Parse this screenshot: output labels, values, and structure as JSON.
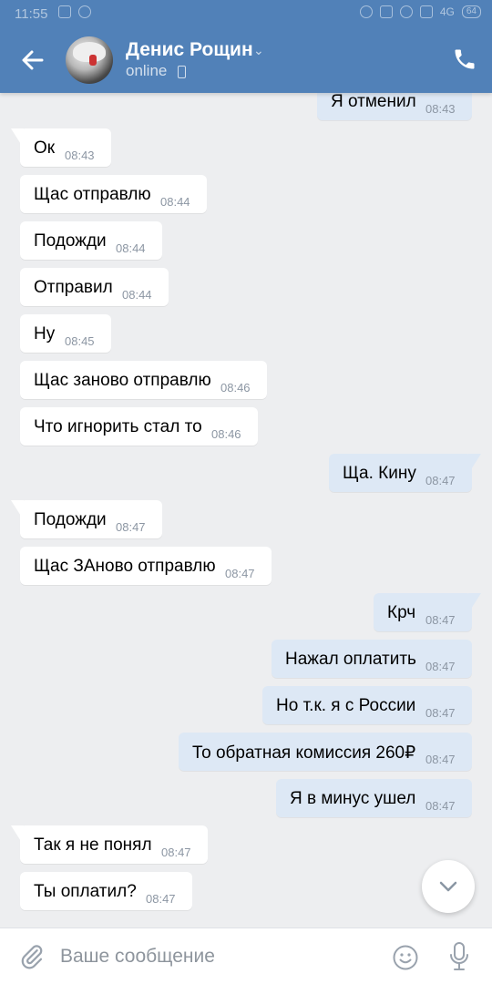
{
  "status_bar": {
    "time": "11:55",
    "network": "4G",
    "battery": "64"
  },
  "header": {
    "contact_name": "Денис Рощин",
    "status": "online",
    "colors": {
      "bar": "#5181b8"
    },
    "icons": {
      "back": "arrow-left-icon",
      "call": "phone-icon",
      "chevron": "chevron-down-icon",
      "device": "mobile-device-icon"
    }
  },
  "messages": [
    {
      "dir": "out",
      "text": "Я отменил",
      "time": "08:43",
      "tail": false
    },
    {
      "dir": "in",
      "text": "Ок",
      "time": "08:43",
      "tail": true
    },
    {
      "dir": "in",
      "text": "Щас отправлю",
      "time": "08:44",
      "tail": false
    },
    {
      "dir": "in",
      "text": "Подожди",
      "time": "08:44",
      "tail": false
    },
    {
      "dir": "in",
      "text": "Отправил",
      "time": "08:44",
      "tail": false
    },
    {
      "dir": "in",
      "text": "Ну",
      "time": "08:45",
      "tail": false
    },
    {
      "dir": "in",
      "text": "Щас заново отправлю",
      "time": "08:46",
      "tail": false
    },
    {
      "dir": "in",
      "text": "Что игнорить стал то",
      "time": "08:46",
      "tail": false
    },
    {
      "dir": "out",
      "text": "Ща. Кину",
      "time": "08:47",
      "tail": true
    },
    {
      "dir": "in",
      "text": "Подожди",
      "time": "08:47",
      "tail": true
    },
    {
      "dir": "in",
      "text": "Щас ЗАново отправлю",
      "time": "08:47",
      "tail": false
    },
    {
      "dir": "out",
      "text": "Крч",
      "time": "08:47",
      "tail": true
    },
    {
      "dir": "out",
      "text": "Нажал оплатить",
      "time": "08:47",
      "tail": false
    },
    {
      "dir": "out",
      "text": "Но т.к. я с России",
      "time": "08:47",
      "tail": false
    },
    {
      "dir": "out",
      "text": "То обратная комиссия 260₽",
      "time": "08:47",
      "tail": false
    },
    {
      "dir": "out",
      "text": "Я в минус ушел",
      "time": "08:47",
      "tail": false
    },
    {
      "dir": "in",
      "text": "Так я не понял",
      "time": "08:47",
      "tail": true
    },
    {
      "dir": "in",
      "text": "Ты оплатил?",
      "time": "08:47",
      "tail": false
    }
  ],
  "composer": {
    "placeholder": "Ваше сообщение",
    "icons": {
      "attach": "paperclip-icon",
      "emoji": "smiley-icon",
      "mic": "microphone-icon"
    }
  },
  "scroll_button": {
    "icon": "chevron-down-icon"
  },
  "colors": {
    "background": "#edeef0",
    "incoming_bubble": "#ffffff",
    "outgoing_bubble": "#dde8f5",
    "time_text": "#8c96a3"
  }
}
